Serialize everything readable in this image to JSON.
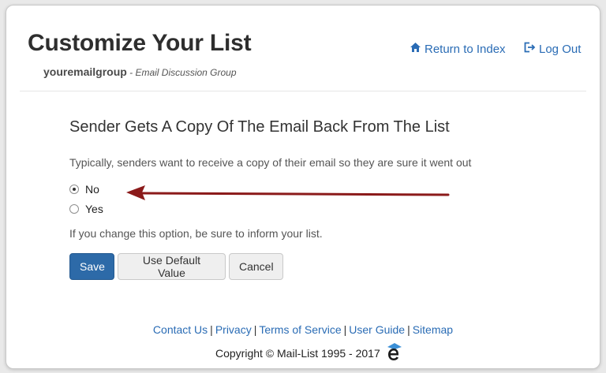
{
  "header": {
    "title": "Customize Your List",
    "group_name": "youremailgroup",
    "separator": " - ",
    "group_description": "Email Discussion Group",
    "return_label": "Return to Index",
    "logout_label": "Log Out"
  },
  "setting": {
    "title": "Sender Gets A Copy Of The Email Back From The List",
    "help_text": "Typically, senders want to receive a copy of their email so they are sure it went out",
    "options": [
      {
        "label": "No",
        "selected": true
      },
      {
        "label": "Yes",
        "selected": false
      }
    ],
    "note": "If you change this option, be sure to inform your list."
  },
  "buttons": {
    "save_label": "Save",
    "default_label": "Use Default Value",
    "cancel_label": "Cancel"
  },
  "footer": {
    "links": [
      "Contact Us",
      "Privacy",
      "Terms of Service",
      "User Guide",
      "Sitemap"
    ],
    "separator": "|",
    "copyright": "Copyright © Mail-List 1995 - 2017"
  },
  "colors": {
    "link": "#2a6cb5",
    "primary_button": "#2d6aa8",
    "annotation_arrow": "#8b1a1a"
  },
  "icons": {
    "return": "home-icon",
    "logout": "logout-icon",
    "brand": "mail-list-logo-icon"
  }
}
